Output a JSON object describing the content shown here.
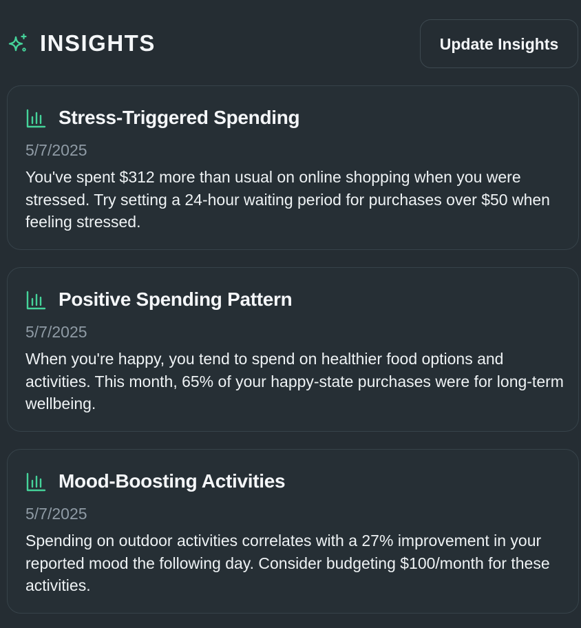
{
  "header": {
    "title": "INSIGHTS",
    "icon": "sparkle-icon",
    "update_button_label": "Update Insights"
  },
  "colors": {
    "background": "#252d33",
    "accent": "#45d39a",
    "card_border": "#37434a",
    "muted_text": "#8f9ba5"
  },
  "insights": [
    {
      "icon": "bar-chart-icon",
      "title": "Stress-Triggered Spending",
      "date": "5/7/2025",
      "body": "You've spent $312 more than usual on online shopping when you were stressed. Try setting a 24-hour waiting period for purchases over $50 when feeling stressed."
    },
    {
      "icon": "bar-chart-icon",
      "title": "Positive Spending Pattern",
      "date": "5/7/2025",
      "body": "When you're happy, you tend to spend on healthier food options and activities. This month, 65% of your happy-state purchases were for long-term wellbeing."
    },
    {
      "icon": "bar-chart-icon",
      "title": "Mood-Boosting Activities",
      "date": "5/7/2025",
      "body": "Spending on outdoor activities correlates with a 27% improvement in your reported mood the following day. Consider budgeting $100/month for these activities."
    }
  ]
}
